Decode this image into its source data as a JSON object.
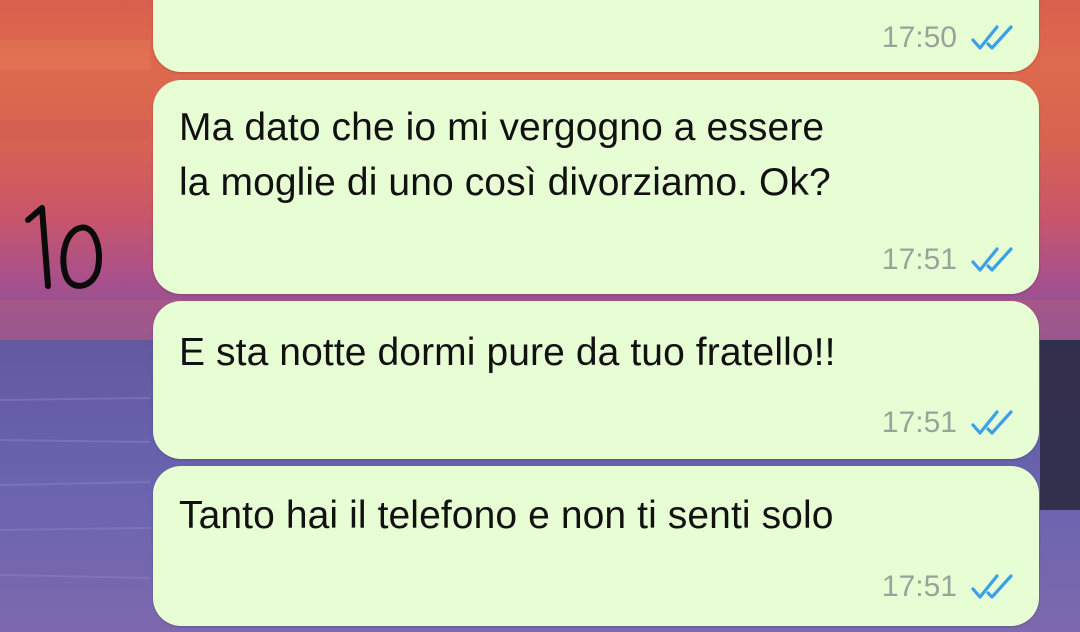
{
  "wallpaper": {
    "handwritten_number": "10"
  },
  "messages": [
    {
      "text": "",
      "time": "17:50",
      "status_icon": "double-check-read-icon"
    },
    {
      "text": "Ma dato che io mi vergogno a essere\nla moglie di uno così divorziamo. Ok?",
      "time": "17:51",
      "status_icon": "double-check-read-icon"
    },
    {
      "text": "E sta notte dormi pure da tuo fratello!!",
      "time": "17:51",
      "status_icon": "double-check-read-icon"
    },
    {
      "text": "Tanto hai il telefono e non ti senti solo",
      "time": "17:51",
      "status_icon": "double-check-read-icon"
    }
  ],
  "colors": {
    "bubble": "#e7fdd4",
    "tick_read": "#3aa0e8",
    "time_text": "#9aa39a"
  }
}
